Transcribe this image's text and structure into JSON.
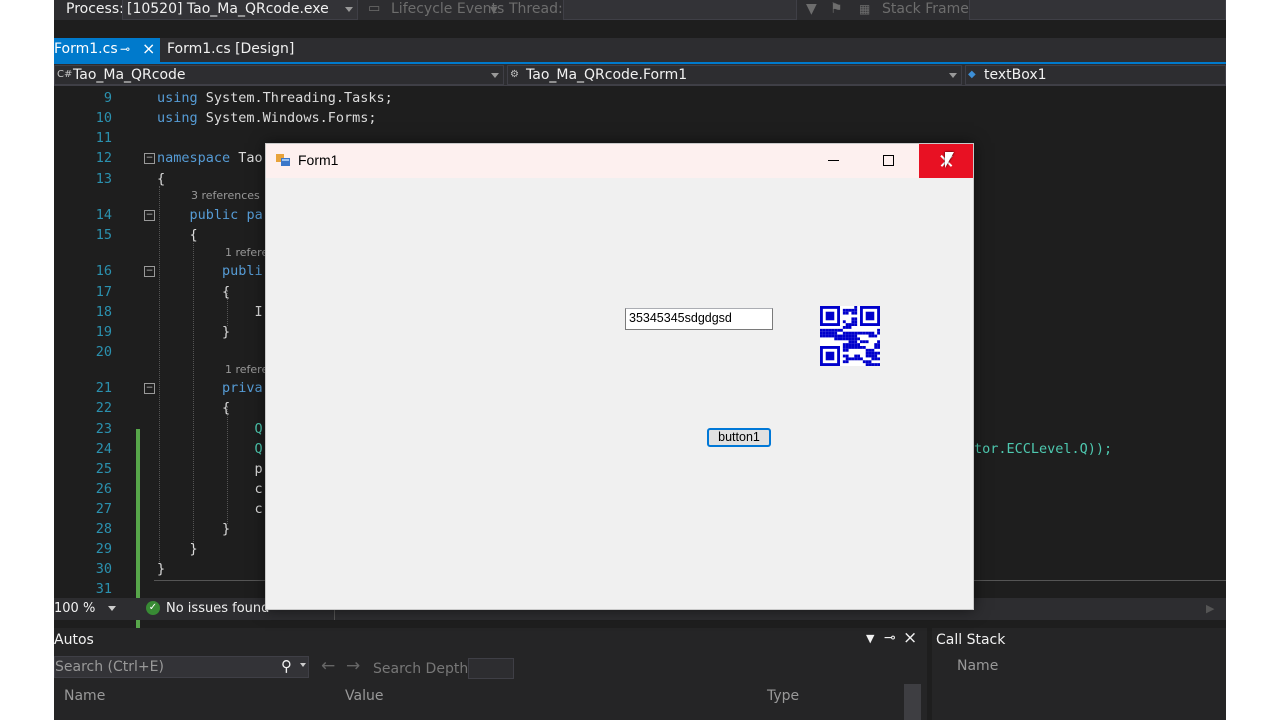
{
  "debug_toolbar": {
    "process_label": "Process:",
    "process_value": "[10520] Tao_Ma_QRcode.exe",
    "lifecycle_label": "Lifecycle Events",
    "thread_label": "Thread:",
    "stack_frame_label": "Stack Frame:"
  },
  "tabs": [
    {
      "label": "Form1.cs",
      "active": true
    },
    {
      "label": "Form1.cs [Design]",
      "active": false
    }
  ],
  "navbar": {
    "project": "Tao_Ma_QRcode",
    "class": "Tao_Ma_QRcode.Form1",
    "member": "textBox1"
  },
  "code": {
    "line_numbers": [
      "9",
      "10",
      "11",
      "12",
      "13",
      "14",
      "15",
      "16",
      "17",
      "18",
      "19",
      "20",
      "21",
      "22",
      "23",
      "24",
      "25",
      "26",
      "27",
      "28",
      "29",
      "30",
      "31"
    ],
    "using1": "System.Threading.Tasks;",
    "using2": "System.Windows.Forms;",
    "namespace_kw": "namespace",
    "namespace_name": "Tao",
    "using_kw": "using",
    "refs_3": "3 references",
    "refs_1a": "1 refere",
    "refs_1b": "1 refere",
    "public_kw": "public",
    "public_pa": "pa",
    "publi": "publi",
    "priva": "priva",
    "ecc_tail": "tor.ECCLevel.Q));"
  },
  "editor_status": {
    "zoom": "100 %",
    "issues": "No issues found"
  },
  "autos": {
    "title": "Autos",
    "search_placeholder": "Search (Ctrl+E)",
    "search_depth_label": "Search Depth:",
    "columns": [
      "Name",
      "Value",
      "Type"
    ]
  },
  "callstack": {
    "title": "Call Stack",
    "column": "Name"
  },
  "form": {
    "title": "Form1",
    "textbox_value": "35345345sdgdgsd",
    "button_label": "button1",
    "qr_color": "#0000cc"
  }
}
